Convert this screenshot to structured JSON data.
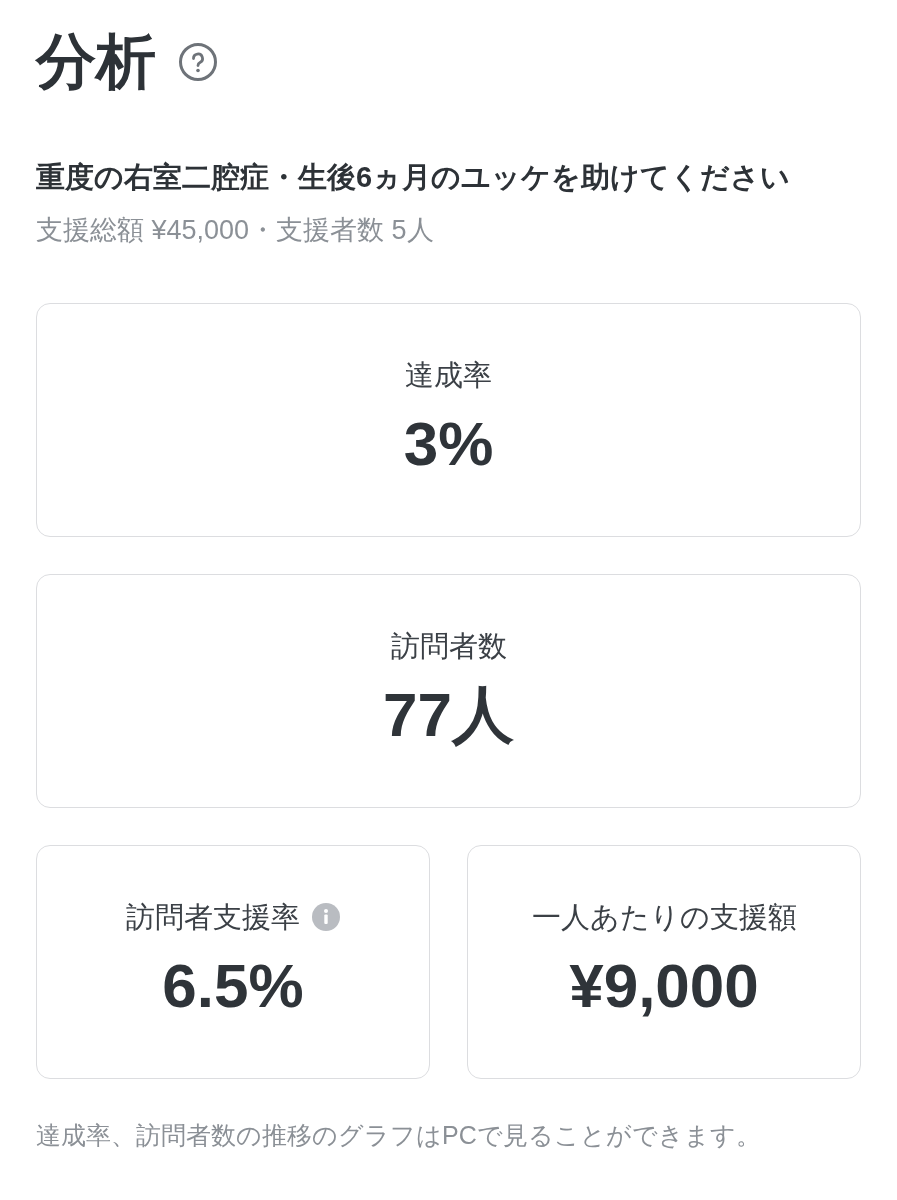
{
  "header": {
    "title": "分析"
  },
  "campaign": {
    "title": "重度の右室二腔症・生後6ヵ月のユッケを助けてください",
    "summary": "支援総額 ¥45,000・支援者数 5人"
  },
  "metrics": [
    {
      "kind": "wide",
      "label": "達成率",
      "value": "3%",
      "info": false
    },
    {
      "kind": "wide",
      "label": "訪問者数",
      "value": "77人",
      "info": false
    },
    {
      "kind": "half",
      "label": "訪問者支援率",
      "value": "6.5%",
      "info": true
    },
    {
      "kind": "half",
      "label": "一人あたりの支援額",
      "value": "¥9,000",
      "info": false
    }
  ],
  "footer_note": "達成率、訪問者数の推移のグラフはPCで見ることができます。"
}
